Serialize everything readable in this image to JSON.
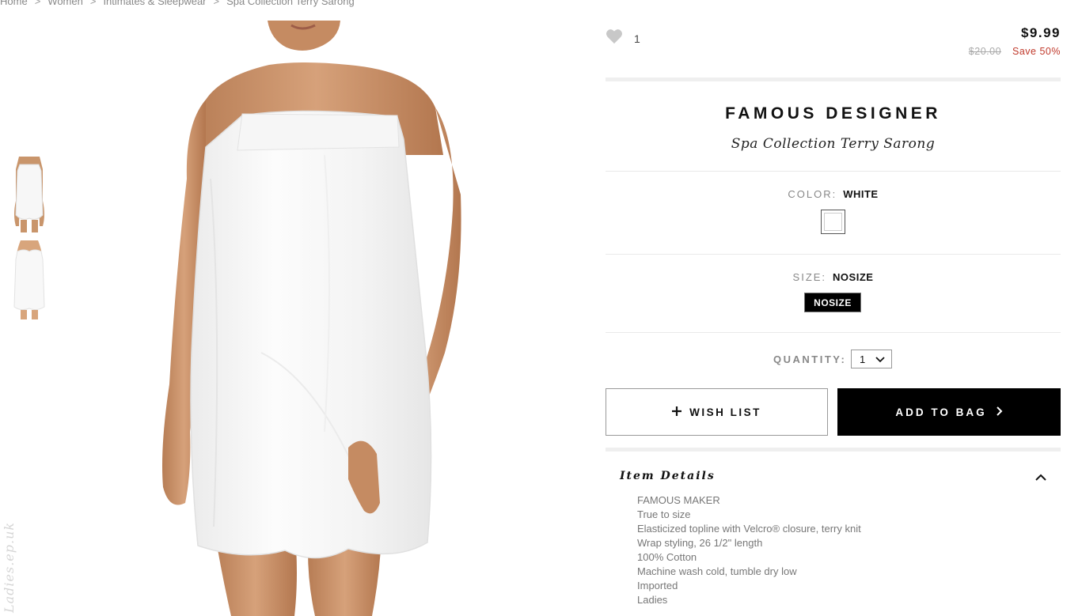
{
  "breadcrumb": {
    "items": [
      "Home",
      "Women",
      "Intimates & Sleepwear",
      "Spa Collection Terry Sarong"
    ],
    "separator": ">"
  },
  "watermark": "Ladies.ep.uk",
  "likes": {
    "count": "1",
    "icon": "heart-icon"
  },
  "price": {
    "current": "$9.99",
    "original": "$20.00",
    "save": "Save 50%",
    "save_color": "#c0392b"
  },
  "product": {
    "brand": "FAMOUS DESIGNER",
    "name": "Spa Collection Terry Sarong"
  },
  "color": {
    "label": "COLOR:",
    "value": "WHITE",
    "swatch": "#ffffff"
  },
  "size": {
    "label": "SIZE:",
    "value": "NOSIZE",
    "option": "NOSIZE"
  },
  "quantity": {
    "label": "QUANTITY:",
    "value": "1"
  },
  "actions": {
    "wishlist": "WISH LIST",
    "wishlist_icon": "plus-icon",
    "add_to_bag": "ADD TO BAG",
    "add_to_bag_icon": "chevron-right-icon"
  },
  "details": {
    "title": "Item Details",
    "toggle_icon": "chevron-up-icon",
    "items": [
      "FAMOUS MAKER",
      "True to size",
      "Elasticized topline with Velcro® closure, terry knit",
      "Wrap styling, 26 1/2\" length",
      "100% Cotton",
      "Machine wash cold, tumble dry low",
      "Imported",
      "Ladies"
    ]
  }
}
